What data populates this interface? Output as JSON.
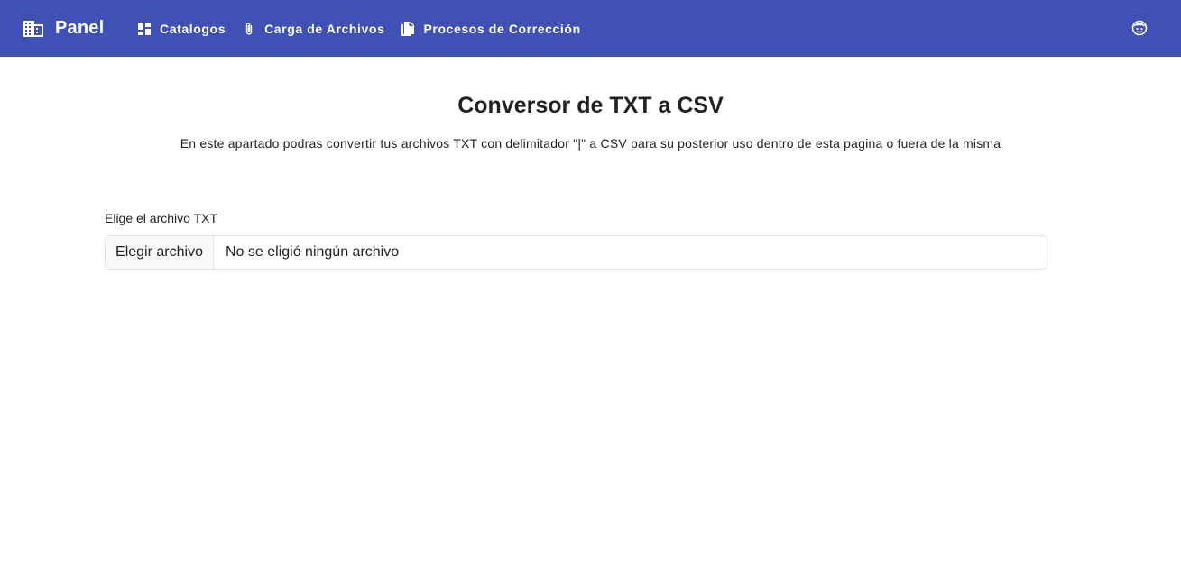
{
  "header": {
    "brand": "Panel",
    "brand_icon": "building-icon",
    "background": "#3f51b5",
    "nav": [
      {
        "label": "Catalogos",
        "icon": "dashboard-icon"
      },
      {
        "label": "Carga de Archivos",
        "icon": "paperclip-icon"
      },
      {
        "label": "Procesos de Corrección",
        "icon": "documents-icon"
      }
    ],
    "account_icon": "user-face-icon"
  },
  "main": {
    "title": "Conversor de TXT a CSV",
    "subtitle": "En este apartado podras convertir tus archivos TXT con delimitador \"|\" a CSV para su posterior uso dentro de esta pagina o fuera de la misma",
    "file_field": {
      "label": "Elige el archivo TXT",
      "button_label": "Elegir archivo",
      "status": "No se eligió ningún archivo"
    }
  }
}
